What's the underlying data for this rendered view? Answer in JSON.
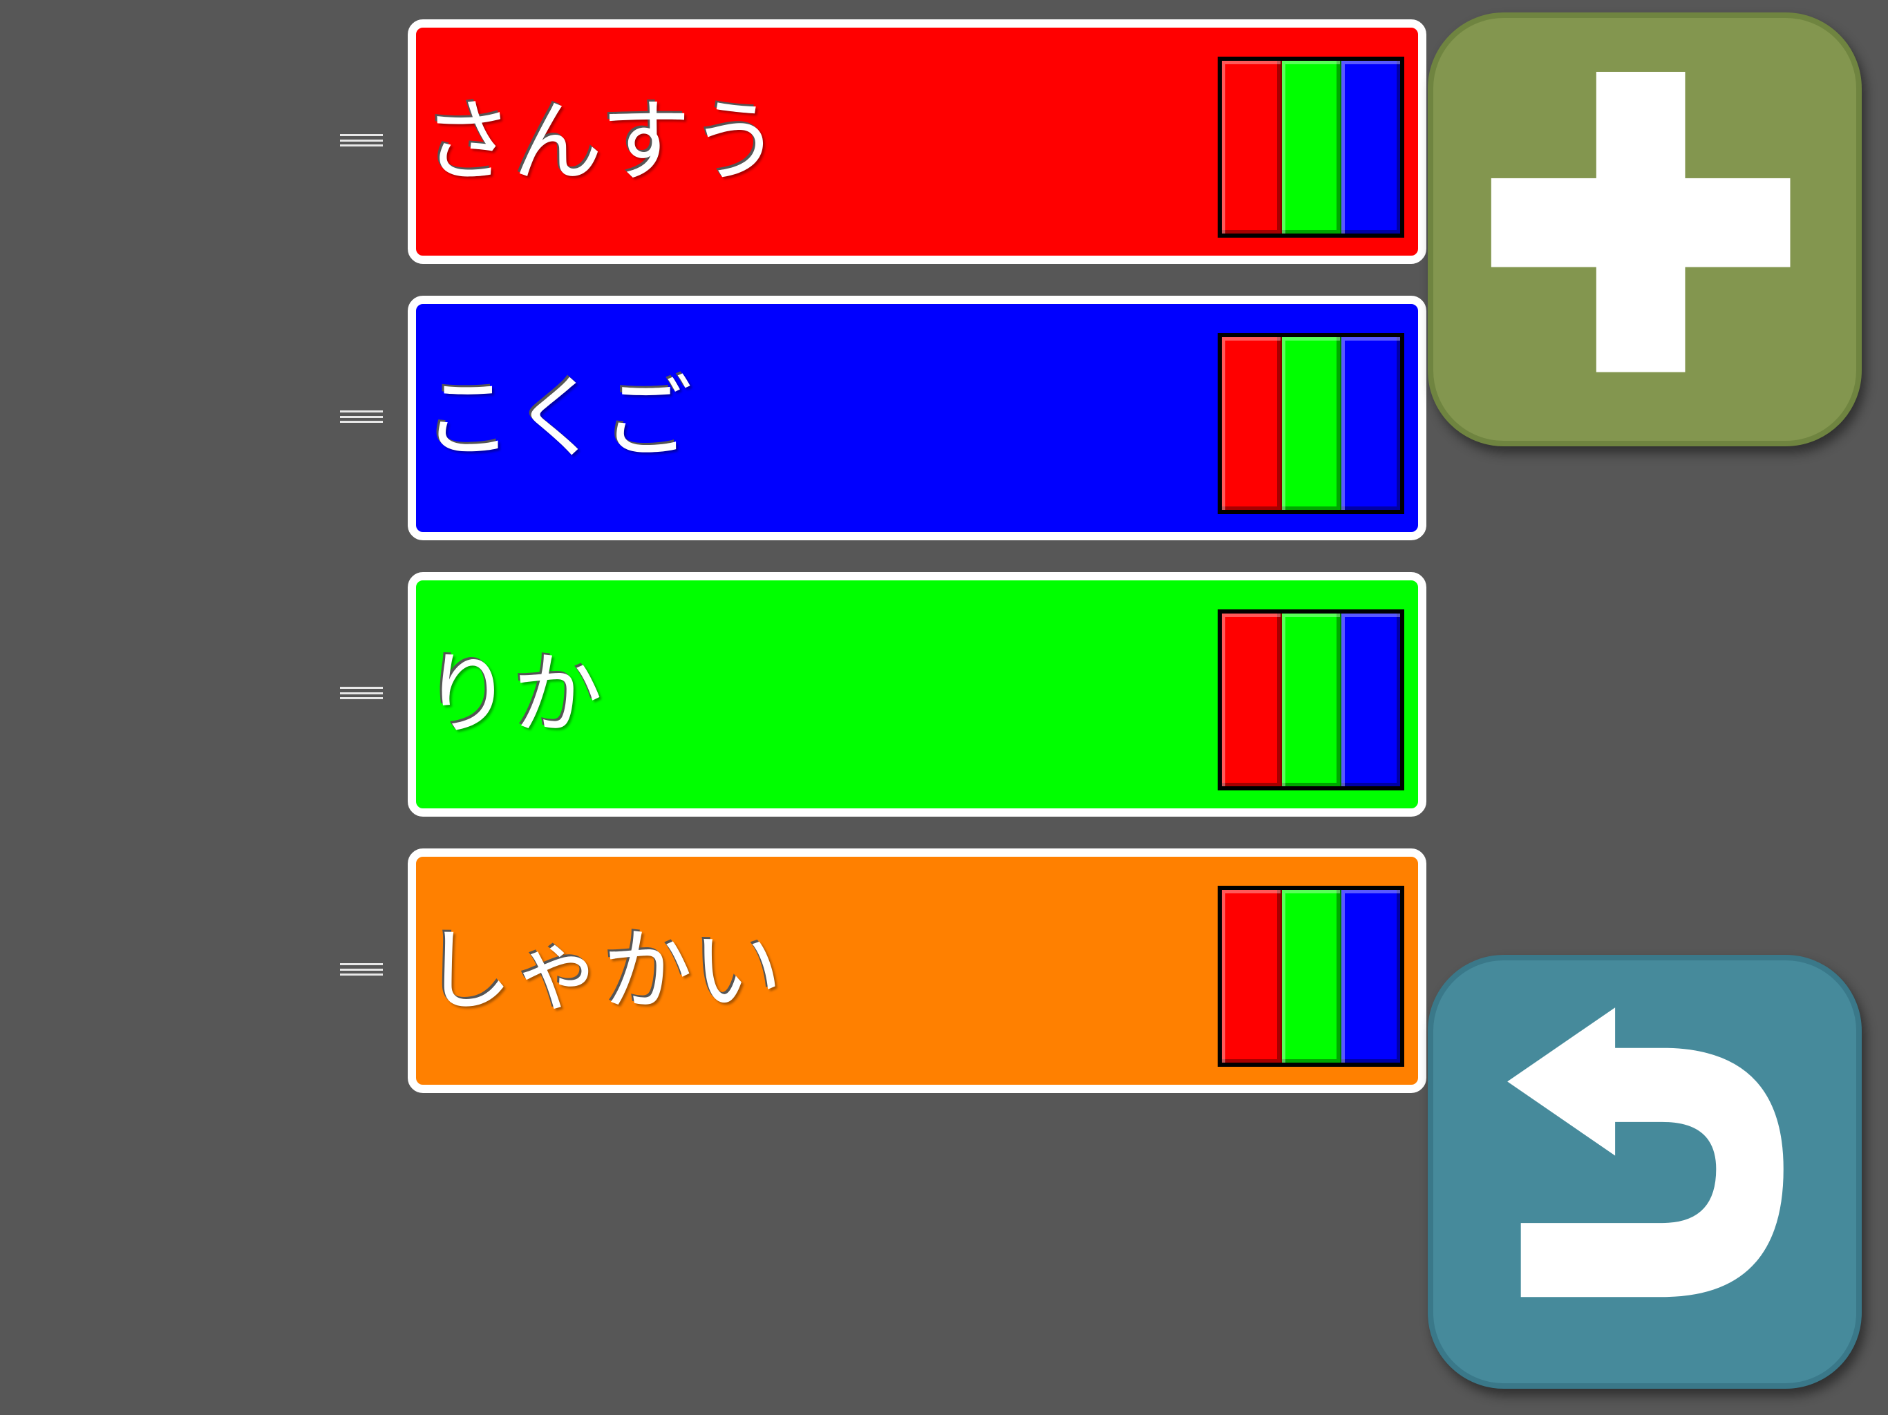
{
  "subjects": [
    {
      "label": "さんすう",
      "color": "#ff0000"
    },
    {
      "label": "こくご",
      "color": "#0000ff"
    },
    {
      "label": "りか",
      "color": "#00ff00"
    },
    {
      "label": "しゃかい",
      "color": "#ff8000"
    }
  ],
  "color_options": [
    "#ff0000",
    "#00ff00",
    "#0000ff"
  ],
  "buttons": {
    "add": {
      "icon": "plus-icon",
      "color": "#83964f"
    },
    "back": {
      "icon": "undo-arrow-icon",
      "color": "#468a9b"
    }
  },
  "background": "#575757"
}
